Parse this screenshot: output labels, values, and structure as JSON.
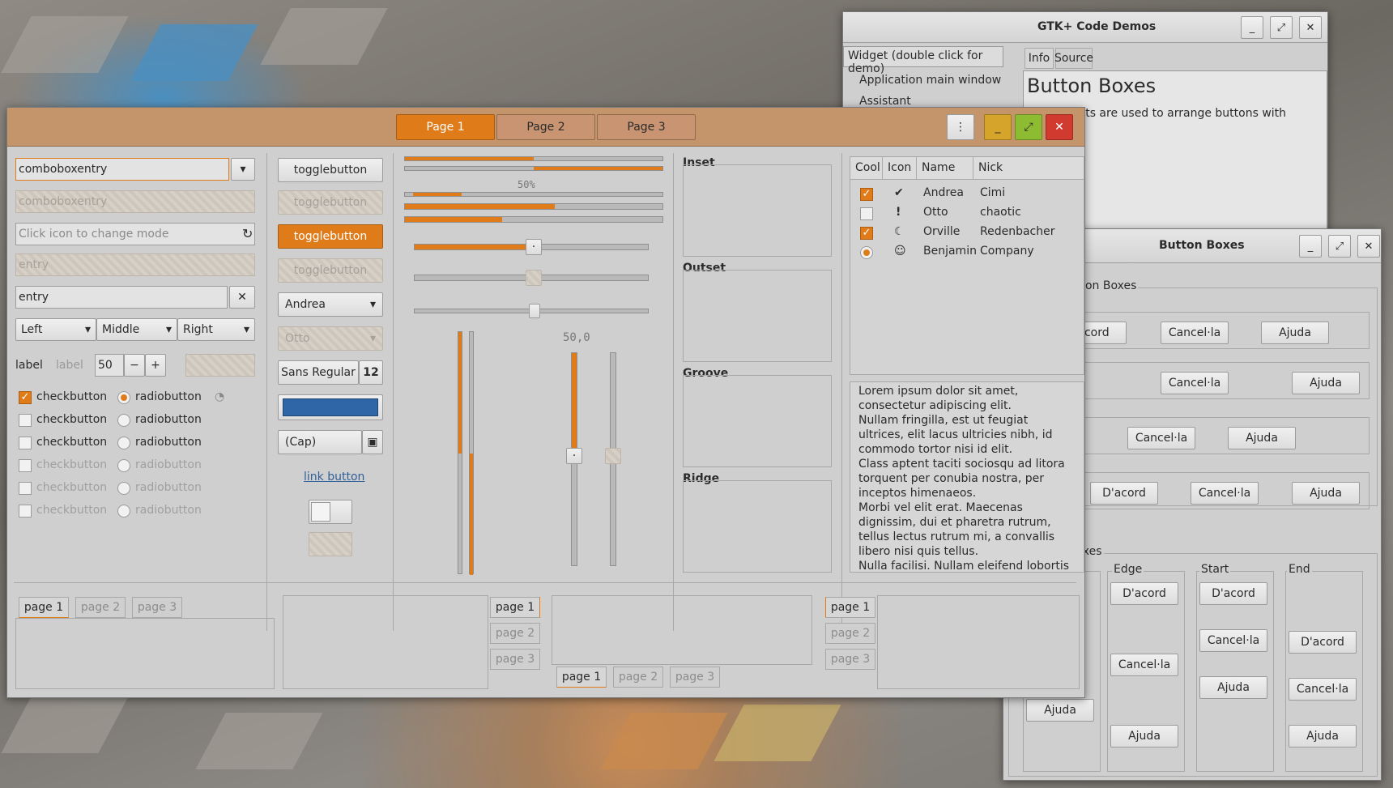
{
  "demo": {
    "title": "GTK+ Code Demos",
    "list_header": "Widget (double click for demo)",
    "items": [
      "Application main window",
      "Assistant"
    ],
    "tabs": [
      "Info",
      "Source"
    ],
    "heading": "Button Boxes",
    "desc": "Box widgets are used to arrange buttons with"
  },
  "bb": {
    "title": "Button Boxes",
    "horiz_label": "tton Boxes",
    "vert_label": "Boxes",
    "ok": "D'acord",
    "cancel": "Cancel·la",
    "help": "Ajuda",
    "ok_cut": "acord",
    "cols": [
      "Edge",
      "Start",
      "End"
    ]
  },
  "main": {
    "tabs": [
      "Page 1",
      "Page 2",
      "Page 3"
    ],
    "entries": {
      "combo1": "comboboxentry",
      "combo2": "comboboxentry",
      "icon_placeholder": "Click icon to change mode",
      "entry_dis": "entry",
      "entry": "entry"
    },
    "combos": [
      "Left",
      "Middle",
      "Right"
    ],
    "labels": [
      "label",
      "label"
    ],
    "spin_value": "50",
    "checks": [
      "checkbutton",
      "checkbutton",
      "checkbutton",
      "checkbutton",
      "checkbutton",
      "checkbutton"
    ],
    "radios": [
      "radiobutton",
      "radiobutton",
      "radiobutton",
      "radiobutton",
      "radiobutton",
      "radiobutton"
    ],
    "toggles": [
      "togglebutton",
      "togglebutton",
      "togglebutton",
      "togglebutton"
    ],
    "combo_andrea": "Andrea",
    "combo_otto": "Otto",
    "font_name": "Sans Regular",
    "font_size": "12",
    "color_value": "#2f66a7",
    "file_btn": "(Cap)",
    "link": "link button",
    "progress_label": "50%",
    "scale_value": "50,0",
    "frames": [
      "Inset",
      "Outset",
      "Groove",
      "Ridge"
    ],
    "tree_headers": [
      "Cool",
      "Icon",
      "Name",
      "Nick"
    ],
    "rows": [
      {
        "name": "Andrea",
        "nick": "Cimi",
        "icon": "check-circle-icon"
      },
      {
        "name": "Otto",
        "nick": "chaotic",
        "icon": "warning-icon"
      },
      {
        "name": "Orville",
        "nick": "Redenbacher",
        "icon": "moon-icon"
      },
      {
        "name": "Benjamin",
        "nick": "Company",
        "icon": "face-icon"
      }
    ],
    "text": "Lorem ipsum dolor sit amet, consectetur adipiscing elit.\nNullam fringilla, est ut feugiat ultrices, elit lacus ultricies nibh, id commodo tortor nisi id elit.\nClass aptent taciti sociosqu ad litora torquent per conubia nostra, per inceptos himenaeos.\nMorbi vel elit erat. Maecenas dignissim, dui et pharetra rutrum, tellus lectus rutrum mi, a convallis libero nisi quis tellus.\nNulla facilisi. Nullam eleifend lobortis",
    "nb_tabs": [
      "page 1",
      "page 2",
      "page 3"
    ],
    "colors": {
      "accent": "#e07b1a",
      "headerbar": "#c4946b",
      "close": "#d13a2e",
      "min": "#d4a52a",
      "max": "#8dbb32"
    }
  }
}
